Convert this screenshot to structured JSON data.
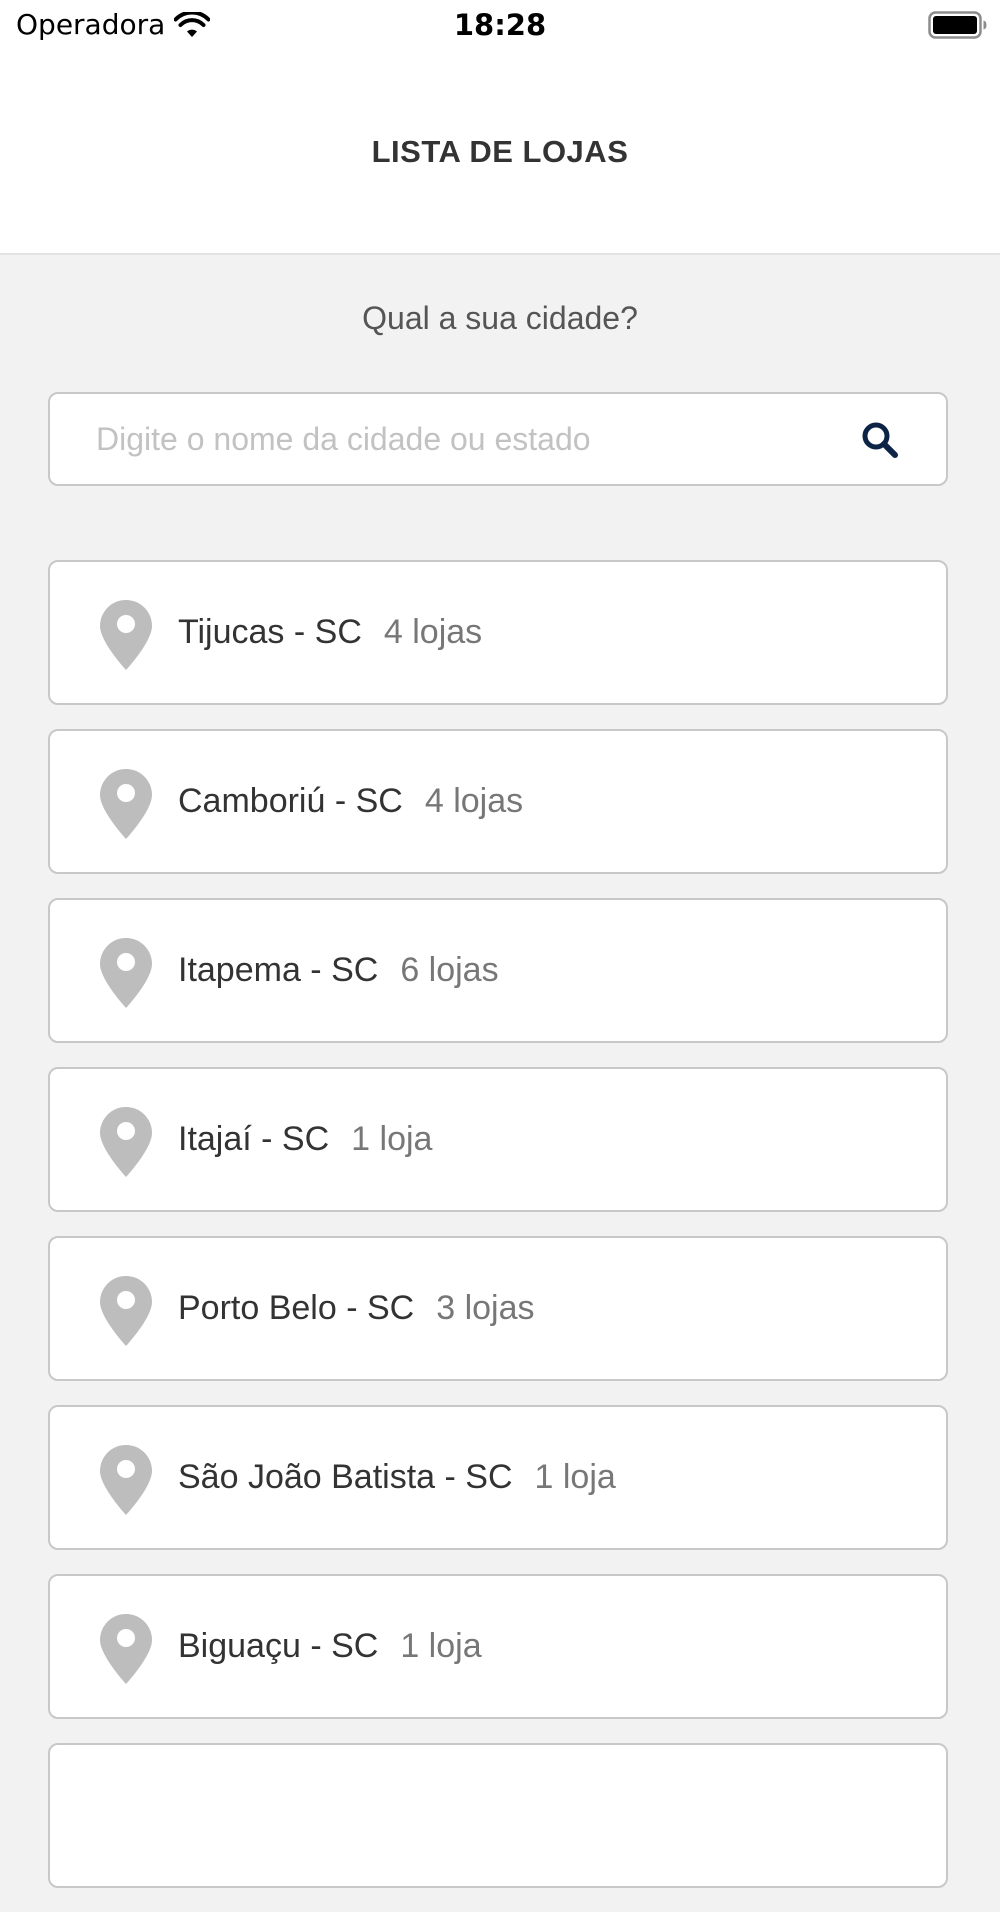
{
  "status_bar": {
    "carrier": "Operadora",
    "time": "18:28"
  },
  "header": {
    "title": "LISTA DE LOJAS"
  },
  "search": {
    "question": "Qual a sua cidade?",
    "placeholder": "Digite o nome da cidade ou estado",
    "value": ""
  },
  "icons": {
    "search": "search-icon",
    "pin": "map-pin-icon",
    "wifi": "wifi-icon",
    "battery": "battery-icon"
  },
  "colors": {
    "background": "#f2f2f2",
    "card": "#ffffff",
    "border": "#c8c8c8",
    "pin": "#bdbdbd",
    "search_icon": "#0d2447",
    "title_text": "#333333",
    "muted_text": "#777777"
  },
  "cities": [
    {
      "name": "Tijucas - SC",
      "count": "4 lojas"
    },
    {
      "name": "Camboriú - SC",
      "count": "4 lojas"
    },
    {
      "name": "Itapema - SC",
      "count": "6 lojas"
    },
    {
      "name": "Itajaí - SC",
      "count": "1 loja"
    },
    {
      "name": "Porto Belo - SC",
      "count": "3 lojas"
    },
    {
      "name": "São João Batista - SC",
      "count": "1 loja"
    },
    {
      "name": "Biguaçu - SC",
      "count": "1 loja"
    },
    {
      "name": "",
      "count": ""
    }
  ]
}
